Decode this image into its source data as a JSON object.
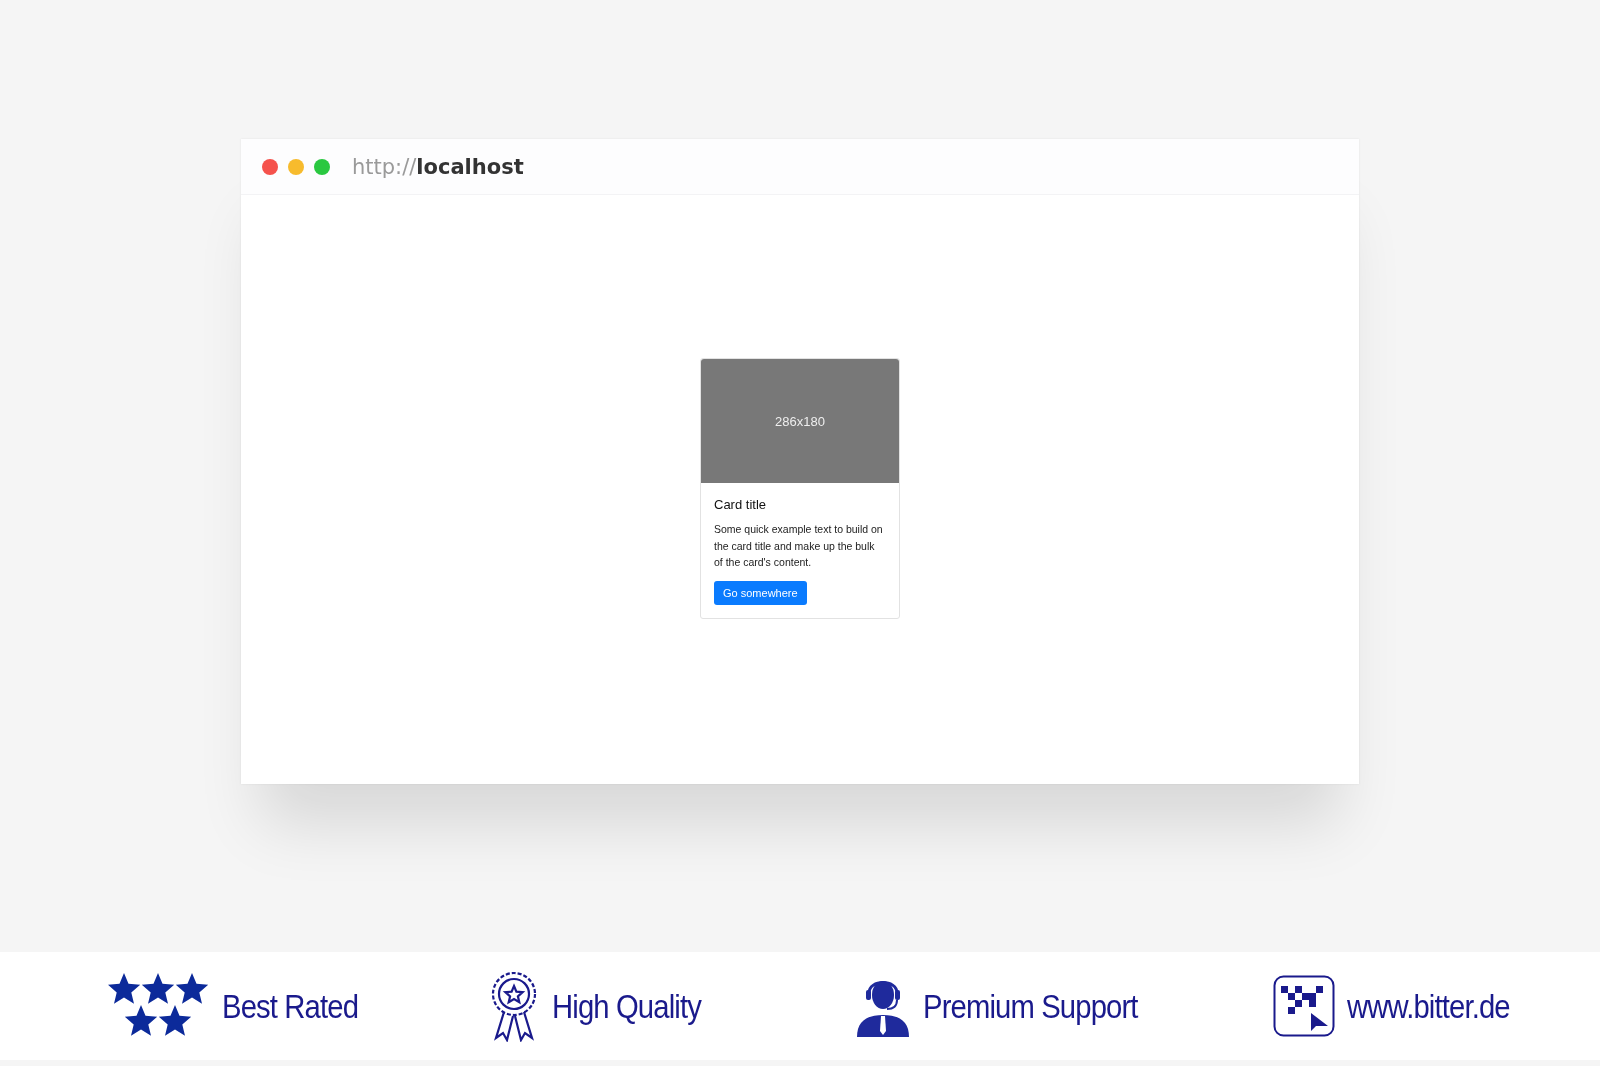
{
  "browser": {
    "url": "http://**localhost**"
  },
  "card": {
    "image_label": "286x180",
    "title": "Card title",
    "text": "Some quick example text to build on the card title and make up the bulk of the card's content.",
    "button": "Go somewhere"
  },
  "footer": {
    "badges": [
      {
        "kind": "stars",
        "label": "Best Rated"
      },
      {
        "kind": "ribbon",
        "label": "High Quality"
      },
      {
        "kind": "support",
        "label": "Premium Support"
      },
      {
        "kind": "logo",
        "label": "www.bitter.de"
      }
    ]
  }
}
